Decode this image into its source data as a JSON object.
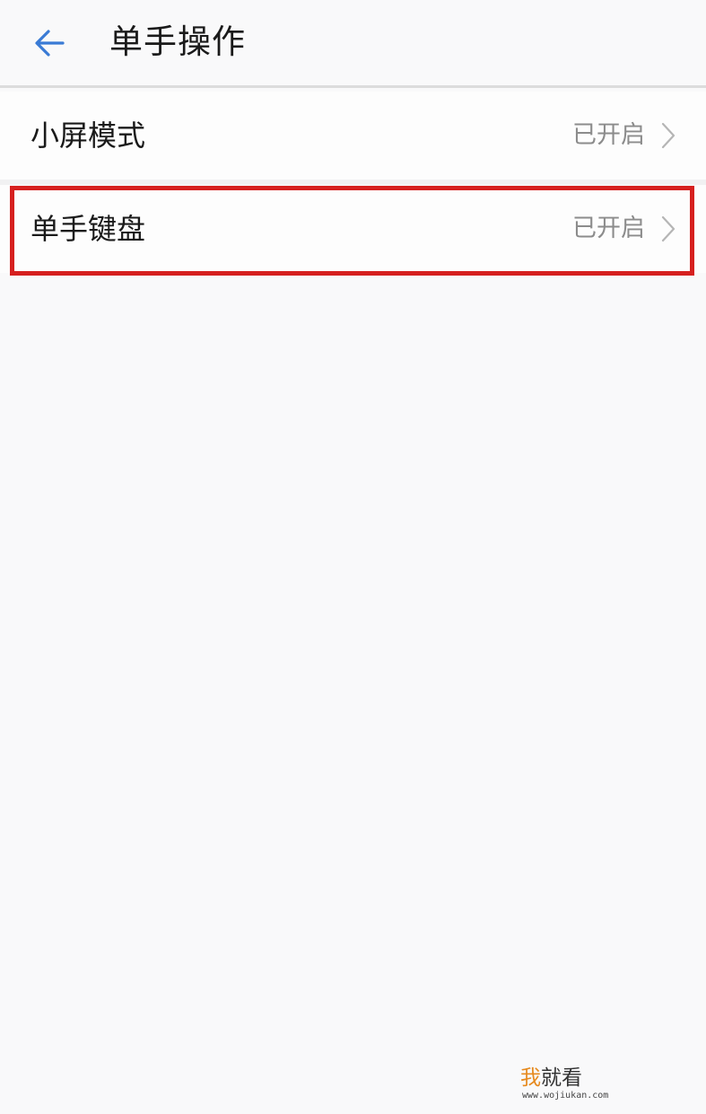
{
  "header": {
    "title": "单手操作",
    "back_icon": "arrow-left-icon",
    "back_icon_color": "#3a7bd5"
  },
  "list": {
    "items": [
      {
        "label": "小屏模式",
        "value": "已开启",
        "icon": "chevron-right-icon"
      },
      {
        "label": "单手键盘",
        "value": "已开启",
        "icon": "chevron-right-icon"
      }
    ]
  },
  "highlight": {
    "color": "#d6201f"
  },
  "watermark": {
    "logo_part1": "我",
    "logo_part2": "就看",
    "url": "www.wojiukan.com"
  }
}
